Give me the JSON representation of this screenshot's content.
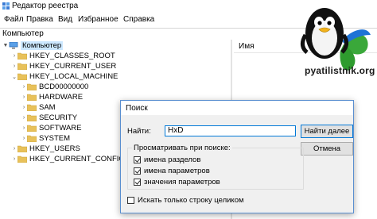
{
  "window": {
    "title": "Редактор реестра"
  },
  "menu": {
    "items": [
      "Файл",
      "Правка",
      "Вид",
      "Избранное",
      "Справка"
    ]
  },
  "address": {
    "path": "Компьютер"
  },
  "tree": {
    "items": [
      {
        "label": "Компьютер",
        "expanded": true,
        "selected": true
      },
      {
        "label": "HKEY_CLASSES_ROOT",
        "expanded": false
      },
      {
        "label": "HKEY_CURRENT_USER",
        "expanded": false
      },
      {
        "label": "HKEY_LOCAL_MACHINE",
        "expanded": true
      },
      {
        "label": "BCD00000000",
        "expanded": false
      },
      {
        "label": "HARDWARE",
        "expanded": false
      },
      {
        "label": "SAM",
        "expanded": false
      },
      {
        "label": "SECURITY",
        "expanded": false
      },
      {
        "label": "SOFTWARE",
        "expanded": false
      },
      {
        "label": "SYSTEM",
        "expanded": false
      },
      {
        "label": "HKEY_USERS",
        "expanded": false
      },
      {
        "label": "HKEY_CURRENT_CONFIG",
        "expanded": false
      }
    ]
  },
  "right_pane": {
    "column_name": "Имя"
  },
  "logo": {
    "text": "pyatilistnik.org"
  },
  "find_dialog": {
    "title": "Поиск",
    "find_label": "Найти:",
    "find_value": "HxD",
    "find_next_button": "Найти далее",
    "cancel_button": "Отмена",
    "look_at_label": "Просматривать при поиске:",
    "options": [
      {
        "label": "имена разделов",
        "checked": true
      },
      {
        "label": "имена параметров",
        "checked": true
      },
      {
        "label": "значения параметров",
        "checked": true
      }
    ],
    "match_whole_label": "Искать только строку целиком",
    "match_whole_checked": false
  },
  "colors": {
    "selection": "#cce8ff",
    "folder": "#e8c15a",
    "dialog_border": "#5a8fd0",
    "accent": "#0078d7"
  }
}
